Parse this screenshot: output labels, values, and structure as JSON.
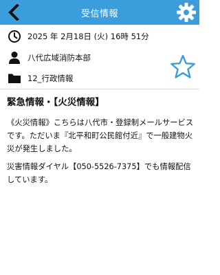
{
  "header": {
    "title": "受信情報",
    "back_icon": "chevron-left-icon",
    "settings_icon": "gear-icon",
    "color": "#3b9ddb"
  },
  "meta": {
    "date": "2025 年 2月18日 (火) 16時 51分",
    "organization": "八代広域消防本部",
    "category": "12_行政情報",
    "icons": [
      "clock-icon",
      "person-icon",
      "folder-icon"
    ]
  },
  "favorite": {
    "icon": "star-outline-icon",
    "color": "#3b9ddb"
  },
  "message": {
    "title": "緊急情報・【火災情報】",
    "paragraph1": "《火災情報》こちらは八代市・登録制メールサービスです。ただいま『北平和町公民館付近』で一般建物火災が発生しました。",
    "paragraph2": "災害情報ダイヤル【050-5526-7375】でも情報配信しています。"
  }
}
